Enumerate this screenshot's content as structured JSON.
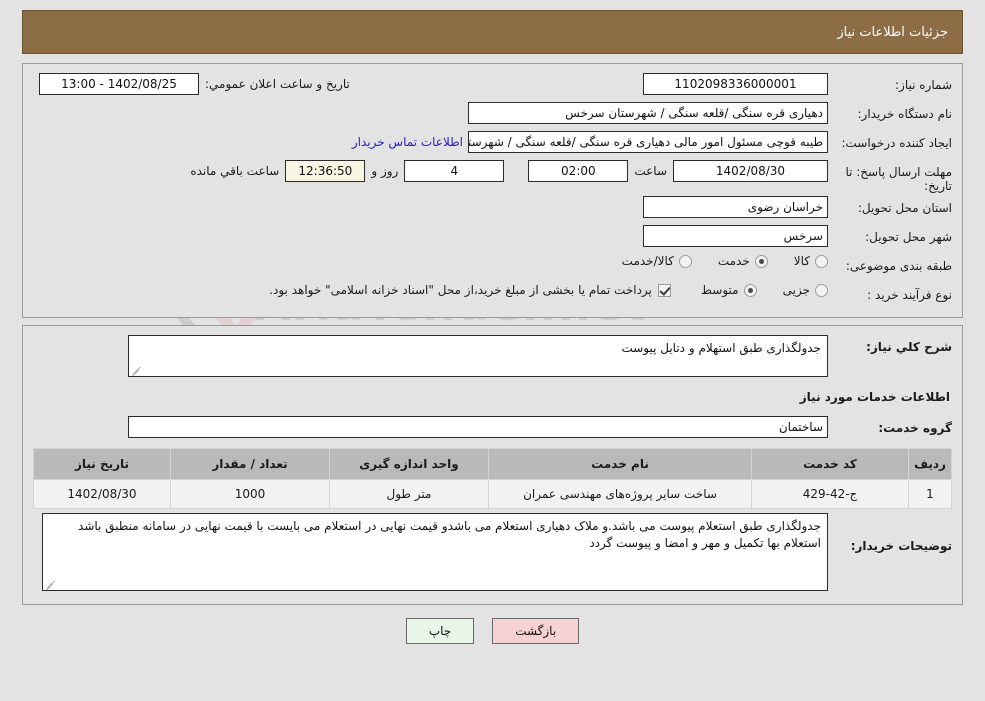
{
  "header": {
    "title": "جزئیات اطلاعات نیاز",
    "bar_color": "#8c6d46"
  },
  "watermark": {
    "text": "AriaTender.net"
  },
  "form": {
    "need_number": {
      "label": "شماره نیاز:",
      "value": "1102098336000001"
    },
    "buyer_org": {
      "label": "نام دستگاه خریدار:",
      "value": "دهیاری قره سنگی /قلعه سنگی / شهرستان سرخس"
    },
    "creator": {
      "label": "ایجاد کننده درخواست:",
      "value": "طیبه قوچی مسئول امور مالی دهیاری قره سنگی /قلعه سنگی / شهرستان سرخس",
      "contact_link": "اطلاعات تماس خریدار"
    },
    "deadline": {
      "label": "مهلت ارسال پاسخ: تا تاریخ:",
      "date": "1402/08/30",
      "hour_label": "ساعت",
      "hour": "02:00",
      "days": "4",
      "days_label": "روز و",
      "countdown": "12:36:50",
      "remaining_label": "ساعت باقي مانده"
    },
    "public_announce": {
      "label": "تاریخ و ساعت اعلان عمومي:",
      "value": "1402/08/25 - 13:00"
    },
    "province": {
      "label": "استان محل تحویل:",
      "value": "خراسان رضوی"
    },
    "city": {
      "label": "شهر محل تحویل:",
      "value": "سرخس"
    },
    "classification": {
      "label": "طبقه بندی موضوعی:",
      "options": [
        {
          "label": "کالا",
          "checked": false
        },
        {
          "label": "خدمت",
          "checked": true
        },
        {
          "label": "کالا/خدمت",
          "checked": false
        }
      ]
    },
    "purchase_type": {
      "label": "نوع فرآیند خرید :",
      "options": [
        {
          "label": "جزیی",
          "checked": false
        },
        {
          "label": "متوسط",
          "checked": true
        }
      ],
      "treasury_checked": true,
      "treasury_note": "پرداخت تمام یا بخشی از مبلغ خرید،از محل \"اسناد خزانه اسلامی\" خواهد بود."
    }
  },
  "need_description": {
    "label": "شرح کلي نیاز:",
    "value": "جدولگذاری طبق استهلام و دتایل پیوست"
  },
  "services_section": {
    "heading": "اطلاعات خدمات مورد نیاز",
    "service_group": {
      "label": "گروه خدمت:",
      "value": "ساختمان"
    }
  },
  "table": {
    "columns": [
      "ردیف",
      "کد خدمت",
      "نام خدمت",
      "واحد اندازه گیری",
      "تعداد / مقدار",
      "تاریخ نیاز"
    ],
    "rows": [
      {
        "row": "1",
        "code": "ج-42-429",
        "name": "ساخت سایر پروژه‌های مهندسی عمران",
        "unit": "متر طول",
        "qty": "1000",
        "date": "1402/08/30"
      }
    ]
  },
  "buyer_notes": {
    "label": "توضیحات خریدار:",
    "value": "جدولگذاری طبق استعلام  پیوست می باشد.و ملاک  دهیاری استعلام  می باشدو قیمت نهایی در استعلام می بایست با قیمت  نهایی در سامانه  منطبق باشد استعلام  بها  تکمیل  و مهر و امضا و پیوست  گردد"
  },
  "footer": {
    "print_label": "چاپ",
    "back_label": "بازگشت"
  }
}
